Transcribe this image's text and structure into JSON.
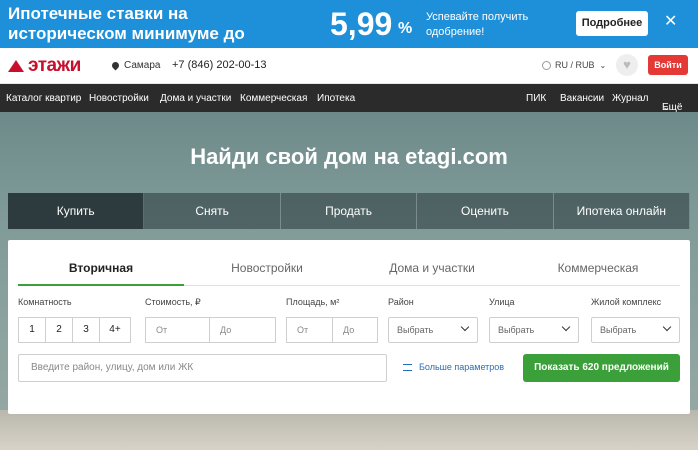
{
  "banner": {
    "title": "Ипотечные ставки на историческом минимуме до",
    "rate": "5,99",
    "percent": "%",
    "subtitle": "Успевайте получить одобрение!",
    "more_label": "Подробнее",
    "close_icon": "close-icon"
  },
  "header": {
    "logo_text": "этажи",
    "city": "Самара",
    "phone": "+7 (846) 202-00-13",
    "lang_currency": "RU / RUB",
    "login_label": "Войти",
    "accent_color": "#e53935"
  },
  "nav": {
    "left": [
      "Каталог квартир",
      "Новостройки",
      "Дома и участки",
      "Коммерческая",
      "Ипотека"
    ],
    "right": [
      "ПИК",
      "Вакансии",
      "Журнал",
      "Ещё"
    ]
  },
  "hero": {
    "title": "Найди свой дом на etagi.com",
    "tabs": [
      "Купить",
      "Снять",
      "Продать",
      "Оценить",
      "Ипотека онлайн"
    ],
    "active_tab": "Купить"
  },
  "panel": {
    "tabs": [
      "Вторичная",
      "Новостройки",
      "Дома и участки",
      "Коммерческая"
    ],
    "active_tab": "Вторичная",
    "labels": {
      "rooms": "Комнатность",
      "price": "Стоимость, ₽",
      "area": "Площадь, м²",
      "district": "Район",
      "street": "Улица",
      "complex": "Жилой комплекс"
    },
    "rooms": [
      "1",
      "2",
      "3",
      "4+"
    ],
    "from": "От",
    "to": "До",
    "select_placeholder": "Выбрать",
    "search_placeholder": "Введите район, улицу, дом или ЖК",
    "more_params": "Больше параметров",
    "show_button": "Показать 620 предложений",
    "button_color": "#3ba03a"
  }
}
